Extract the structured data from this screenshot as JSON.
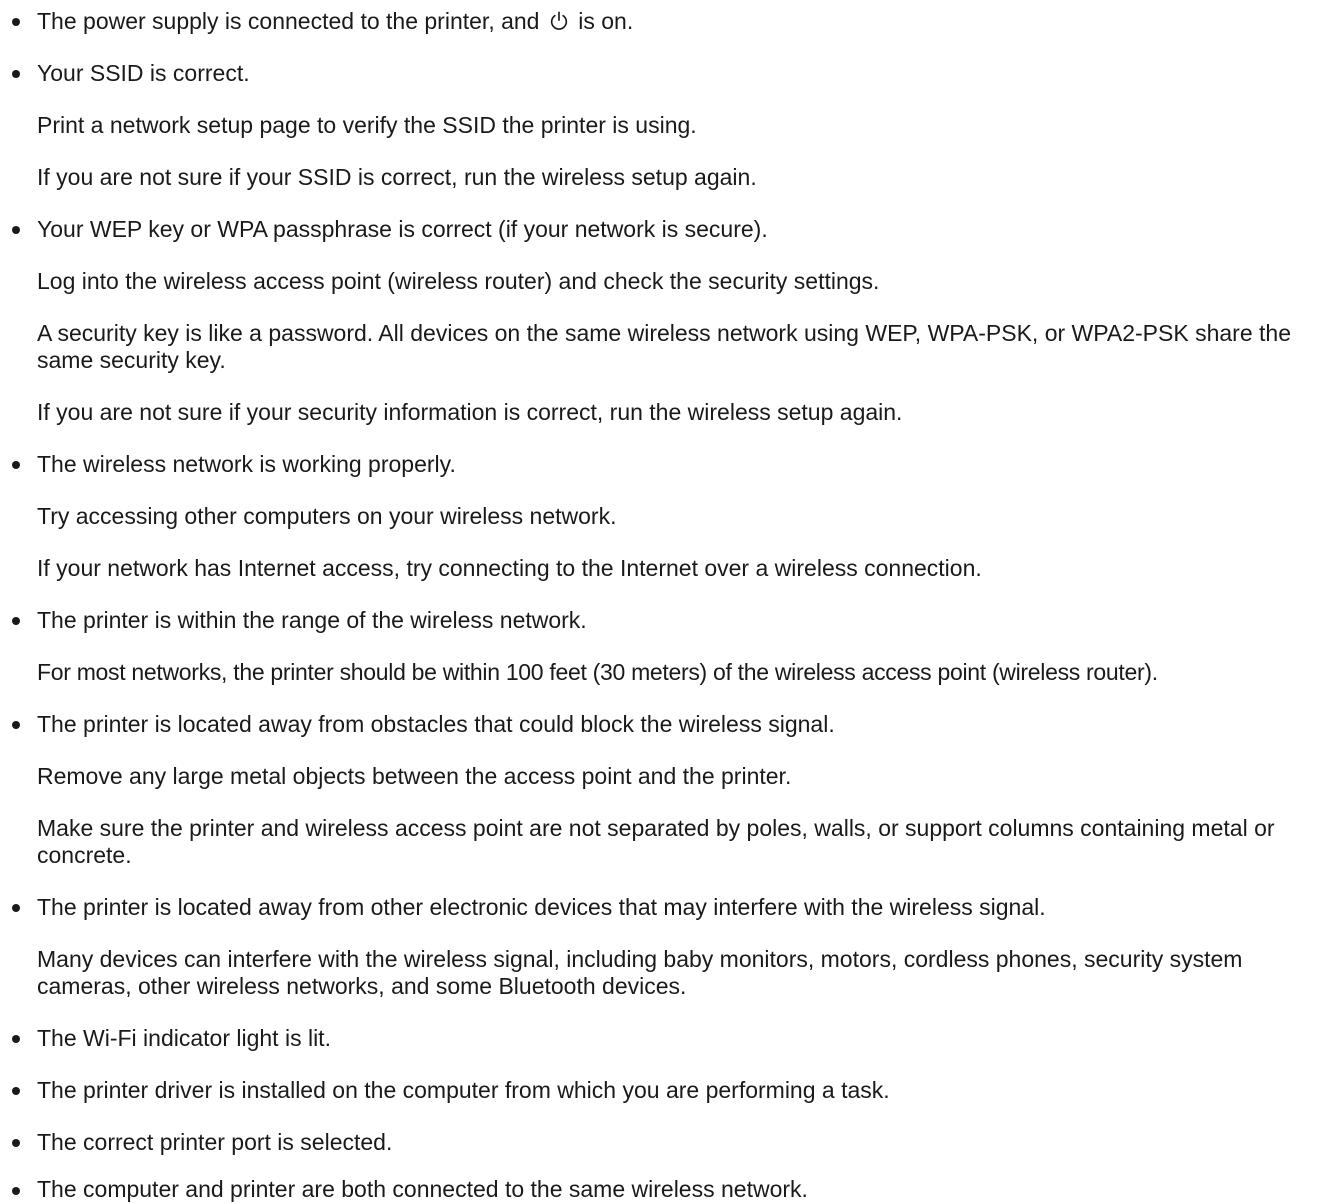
{
  "items": [
    {
      "main_before": "The power supply is connected to the printer, and",
      "main_after": "is on.",
      "icon": "power-icon"
    },
    {
      "main": "Your SSID is correct.",
      "sub": [
        "Print a network setup page to verify the SSID the printer is using.",
        "If you are not sure if your SSID is correct, run the wireless setup again."
      ]
    },
    {
      "main": "Your WEP key or WPA passphrase is correct (if your network is secure).",
      "sub": [
        "Log into the wireless access point (wireless router) and check the security settings.",
        "A security key is like a password. All devices on the same wireless network using WEP, WPA-PSK, or WPA2-PSK share the same security key.",
        "If you are not sure if your security information is correct, run the wireless setup again."
      ]
    },
    {
      "main": "The wireless network is working properly.",
      "sub": [
        "Try accessing other computers on your wireless network.",
        "If your network has Internet access, try connecting to the Internet over a wireless connection."
      ]
    },
    {
      "main": "The printer is within the range of the wireless network.",
      "sub": [
        "For most networks, the printer should be within 100 feet (30 meters) of the wireless access point (wireless router)."
      ]
    },
    {
      "main": "The printer is located away from obstacles that could block the wireless signal.",
      "sub": [
        "Remove any large metal objects between the access point and the printer.",
        "Make sure the printer and wireless access point are not separated by poles, walls, or support columns containing metal or concrete."
      ]
    },
    {
      "main": "The printer is located away from other electronic devices that may interfere with the wireless signal.",
      "sub": [
        "Many devices can interfere with the wireless signal, including baby monitors, motors, cordless phones, security system cameras, other wireless networks, and some Bluetooth devices."
      ]
    },
    {
      "main": "The Wi-Fi indicator light is lit."
    },
    {
      "main": "The printer driver is installed on the computer from which you are performing a task."
    },
    {
      "main": "The correct printer port is selected."
    },
    {
      "main": "The computer and printer are both connected to the same wireless network."
    }
  ]
}
